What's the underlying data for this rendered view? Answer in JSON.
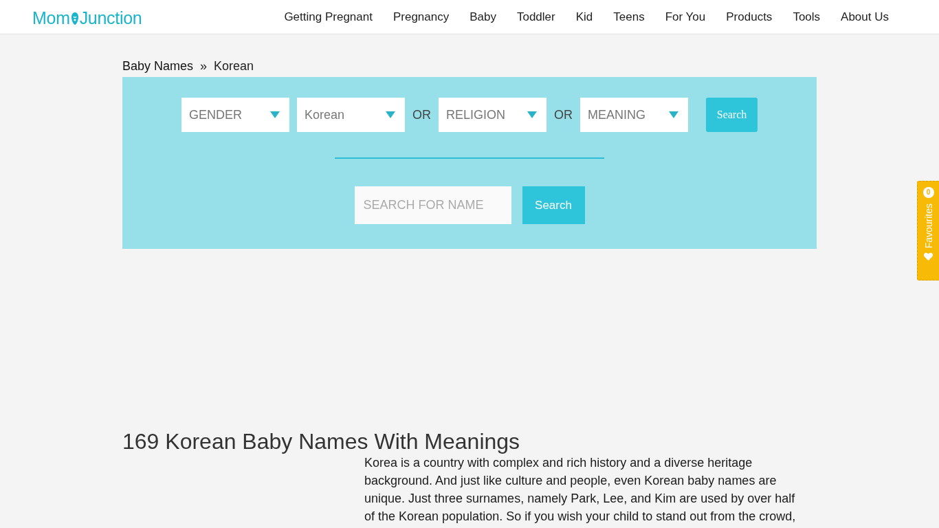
{
  "logo": {
    "left": "Mom",
    "right": "Junction"
  },
  "nav": [
    "Getting Pregnant",
    "Pregnancy",
    "Baby",
    "Toddler",
    "Kid",
    "Teens",
    "For You",
    "Products",
    "Tools",
    "About Us"
  ],
  "breadcrumb": {
    "items": [
      "Baby Names",
      "Korean"
    ],
    "separator": "»"
  },
  "filters": [
    {
      "kind": "dropdown",
      "text": "GENDER"
    },
    {
      "kind": "dropdown",
      "text": "Korean"
    },
    {
      "kind": "separator",
      "text": "OR"
    },
    {
      "kind": "dropdown",
      "text": "RELIGION"
    },
    {
      "kind": "separator",
      "text": "OR"
    },
    {
      "kind": "dropdown",
      "text": "MEANING"
    }
  ],
  "filter_button": "Search",
  "name_search": {
    "placeholder": "SEARCH FOR NAME",
    "button": "Search"
  },
  "heading": "169 Korean Baby Names With Meanings",
  "intro": "Korea is a country with complex and rich history and a diverse heritage background. And just like culture and people, even Korean baby names are unique. Just three surnames, namely Park, Lee, and Kim are used by over half of the Korean population. So if you wish your child to stand out from the crowd,",
  "favourites": {
    "label": "Favourites",
    "count": "0"
  }
}
